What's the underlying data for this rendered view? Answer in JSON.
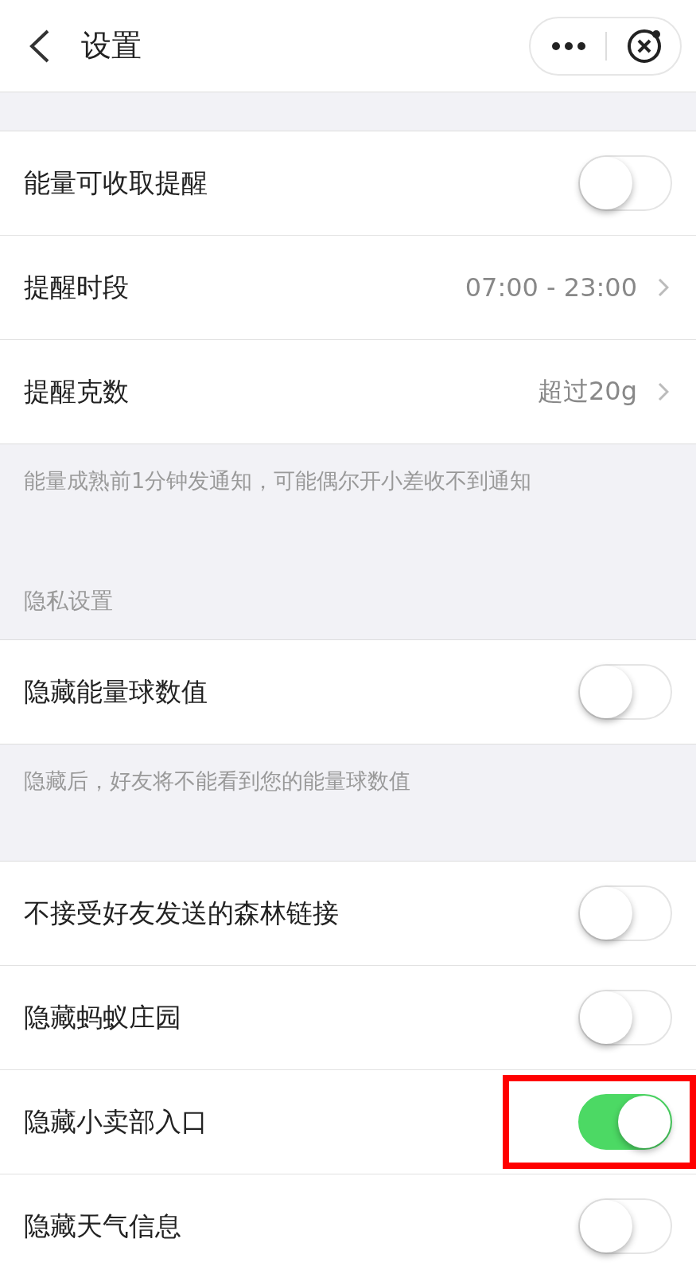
{
  "header": {
    "title": "设置"
  },
  "sections": [
    {
      "rows": [
        {
          "kind": "toggle",
          "label": "能量可收取提醒",
          "on": false
        },
        {
          "kind": "link",
          "label": "提醒时段",
          "value": "07:00 - 23:00"
        },
        {
          "kind": "link",
          "label": "提醒克数",
          "value": "超过20g"
        }
      ],
      "note": "能量成熟前1分钟发通知，可能偶尔开小差收不到通知"
    },
    {
      "label": "隐私设置",
      "rows": [
        {
          "kind": "toggle",
          "label": "隐藏能量球数值",
          "on": false
        }
      ],
      "note": "隐藏后，好友将不能看到您的能量球数值"
    },
    {
      "rows": [
        {
          "kind": "toggle",
          "label": "不接受好友发送的森林链接",
          "on": false
        },
        {
          "kind": "toggle",
          "label": "隐藏蚂蚁庄园",
          "on": false
        },
        {
          "kind": "toggle",
          "label": "隐藏小卖部入口",
          "on": true,
          "highlighted": true
        },
        {
          "kind": "toggle",
          "label": "隐藏天气信息",
          "on": false
        }
      ]
    }
  ]
}
